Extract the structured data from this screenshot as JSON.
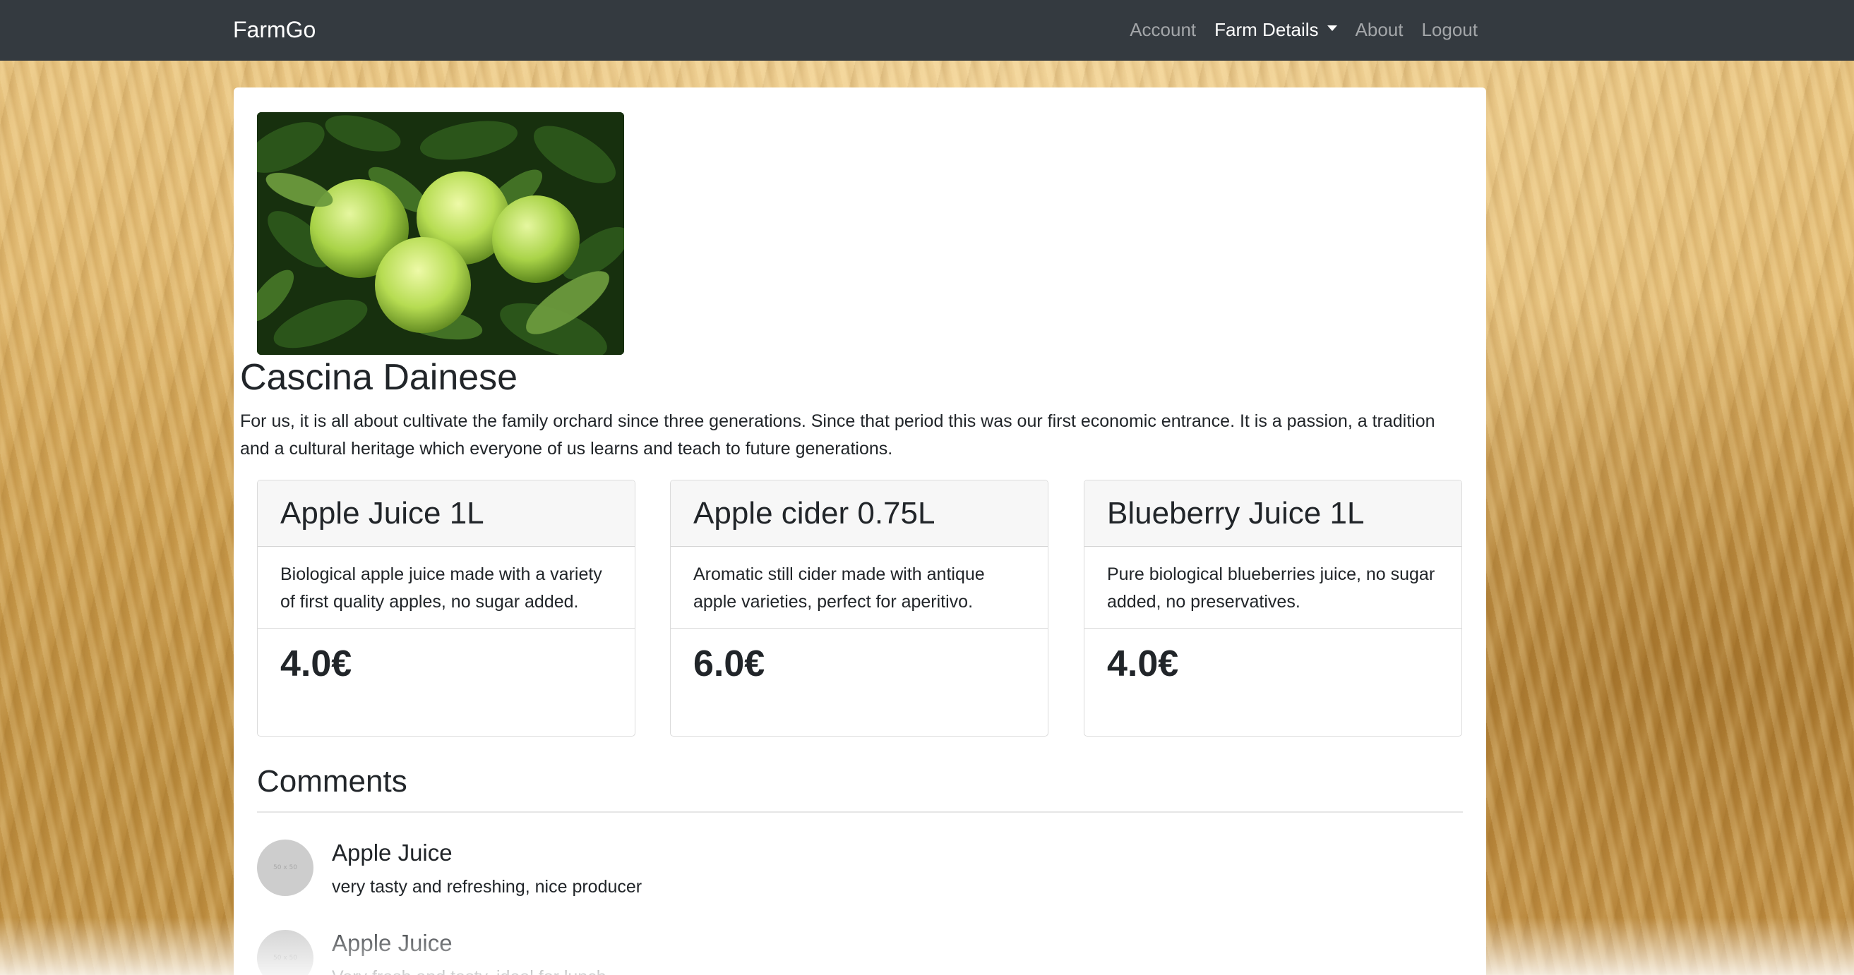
{
  "navbar": {
    "brand": "FarmGo",
    "links": [
      {
        "label": "Account",
        "active": false
      },
      {
        "label": "Farm Details",
        "active": true,
        "dropdown": true
      },
      {
        "label": "About",
        "active": false
      },
      {
        "label": "Logout",
        "active": false
      }
    ]
  },
  "farm": {
    "image_alt": "green apples on tree",
    "name": "Cascina Dainese",
    "description": "For us, it is all about cultivate the family orchard since three generations. Since that period this was our first economic entrance. It is a passion, a tradition and a cultural heritage which everyone of us learns and teach to future generations."
  },
  "products": [
    {
      "name": "Apple Juice 1L",
      "description": "Biological apple juice made with a variety of first quality apples, no sugar added.",
      "price": "4.0€"
    },
    {
      "name": "Apple cider 0.75L",
      "description": "Aromatic still cider made with antique apple varieties, perfect for aperitivo.",
      "price": "6.0€"
    },
    {
      "name": "Blueberry Juice 1L",
      "description": "Pure biological blueberries juice, no sugar added, no preservatives.",
      "price": "4.0€"
    }
  ],
  "comments": {
    "heading": "Comments",
    "avatar_placeholder": "50 x 50",
    "items": [
      {
        "product": "Apple Juice",
        "text": "very tasty and refreshing, nice producer"
      },
      {
        "product": "Apple Juice",
        "text": "Very fresh and tasty, ideal for lunch"
      }
    ]
  },
  "colors": {
    "navbar_bg": "#343a40",
    "card_header_bg": "#f7f7f7",
    "avatar_bg": "#cdcdcd"
  }
}
